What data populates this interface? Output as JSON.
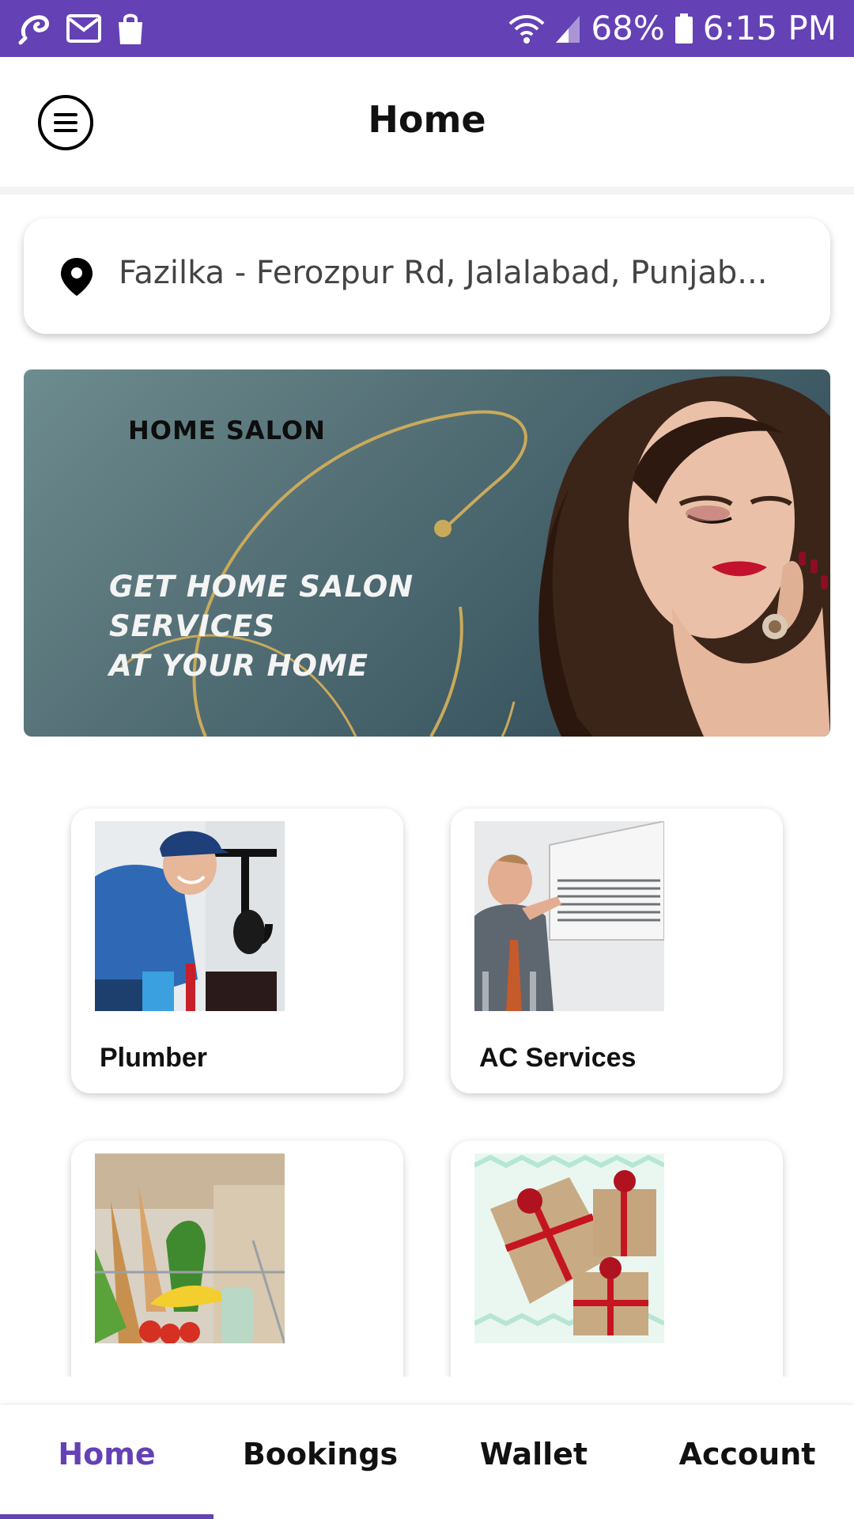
{
  "status_bar": {
    "battery": "68%",
    "time": "6:15 PM",
    "left_icons": [
      "notification-icon",
      "gmail-icon",
      "shopping-bag-icon"
    ],
    "right_icons": [
      "wifi-icon",
      "signal-icon",
      "battery-icon"
    ]
  },
  "header": {
    "title": "Home",
    "menu_icon": "menu-icon"
  },
  "location": {
    "address": "Fazilka - Ferozpur Rd, Jalalabad, Punjab..."
  },
  "banner": {
    "kicker": "HOME SALON",
    "headline_line1": "GET HOME SALON SERVICES",
    "headline_line2": "AT YOUR HOME"
  },
  "services": [
    {
      "label": "Plumber"
    },
    {
      "label": "AC Services"
    },
    {
      "label": ""
    },
    {
      "label": ""
    }
  ],
  "bottom_nav": {
    "items": [
      {
        "label": "Home",
        "active": true
      },
      {
        "label": "Bookings",
        "active": false
      },
      {
        "label": "Wallet",
        "active": false
      },
      {
        "label": "Account",
        "active": false
      }
    ]
  },
  "colors": {
    "primary": "#6441b4",
    "text": "#111111"
  }
}
